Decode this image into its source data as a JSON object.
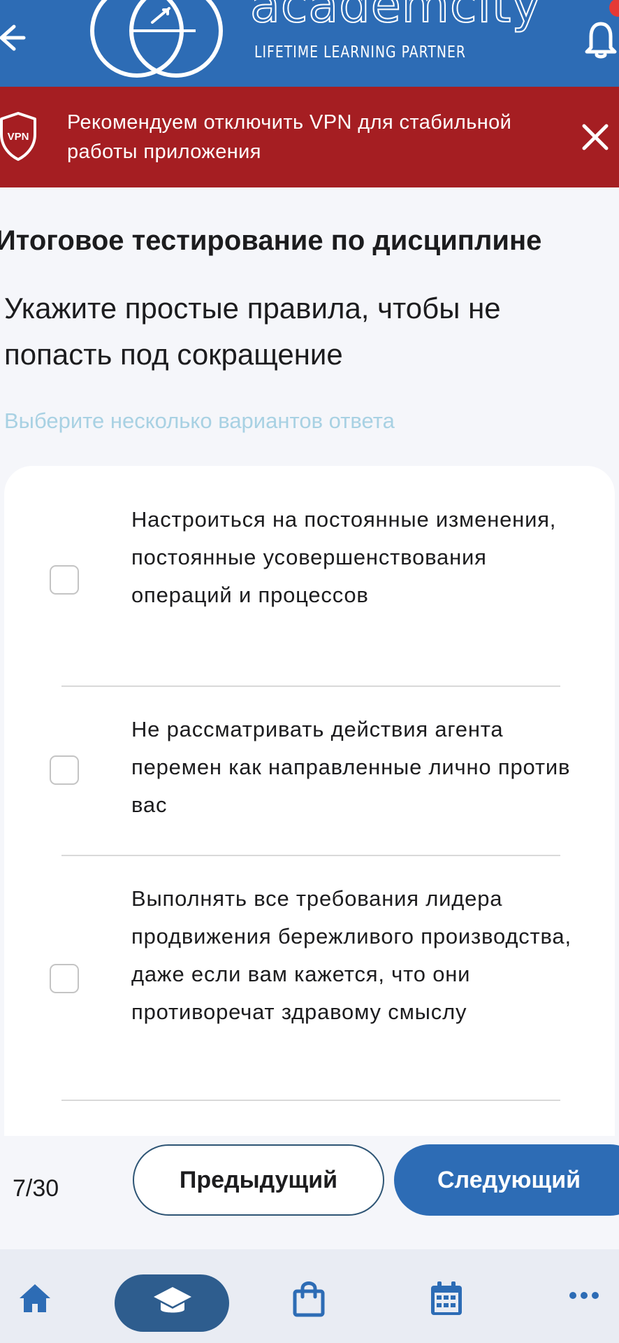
{
  "header": {
    "logo_text": "academcity",
    "logo_tagline": "LIFETIME LEARNING PARTNER",
    "icons": [
      "arrow-left-icon",
      "academcity-logo",
      "bell-icon"
    ],
    "brand_color": "#2d6cb5"
  },
  "banner": {
    "badge": "VPN",
    "text": "Рекомендуем отключить VPN для стабильной работы приложения",
    "color": "#a51e22"
  },
  "test": {
    "title": "Итоговое тестирование по дисциплине",
    "question": "Укажите простые правила, чтобы не попасть под сокращение",
    "hint": "Выберите несколько вариантов ответа",
    "options": [
      {
        "label": "Настроиться на постоянные изменения, постоянные усовершенствования операций и процессов",
        "checked": false
      },
      {
        "label": "Не рассматривать действия агента перемен как направленные лично против вас",
        "checked": false
      },
      {
        "label": "Выполнять все требования лидера продвижения бережливого производства, даже если вам кажется, что они противоречат здравому смыслу",
        "checked": false
      }
    ]
  },
  "pager": {
    "counter": "7/30",
    "prev_label": "Предыдущий",
    "next_label": "Следующий"
  },
  "bottom_nav": {
    "items": [
      "home-icon",
      "courses-icon",
      "shop-icon",
      "calendar-icon",
      "more-icon"
    ],
    "active": "courses-icon"
  }
}
